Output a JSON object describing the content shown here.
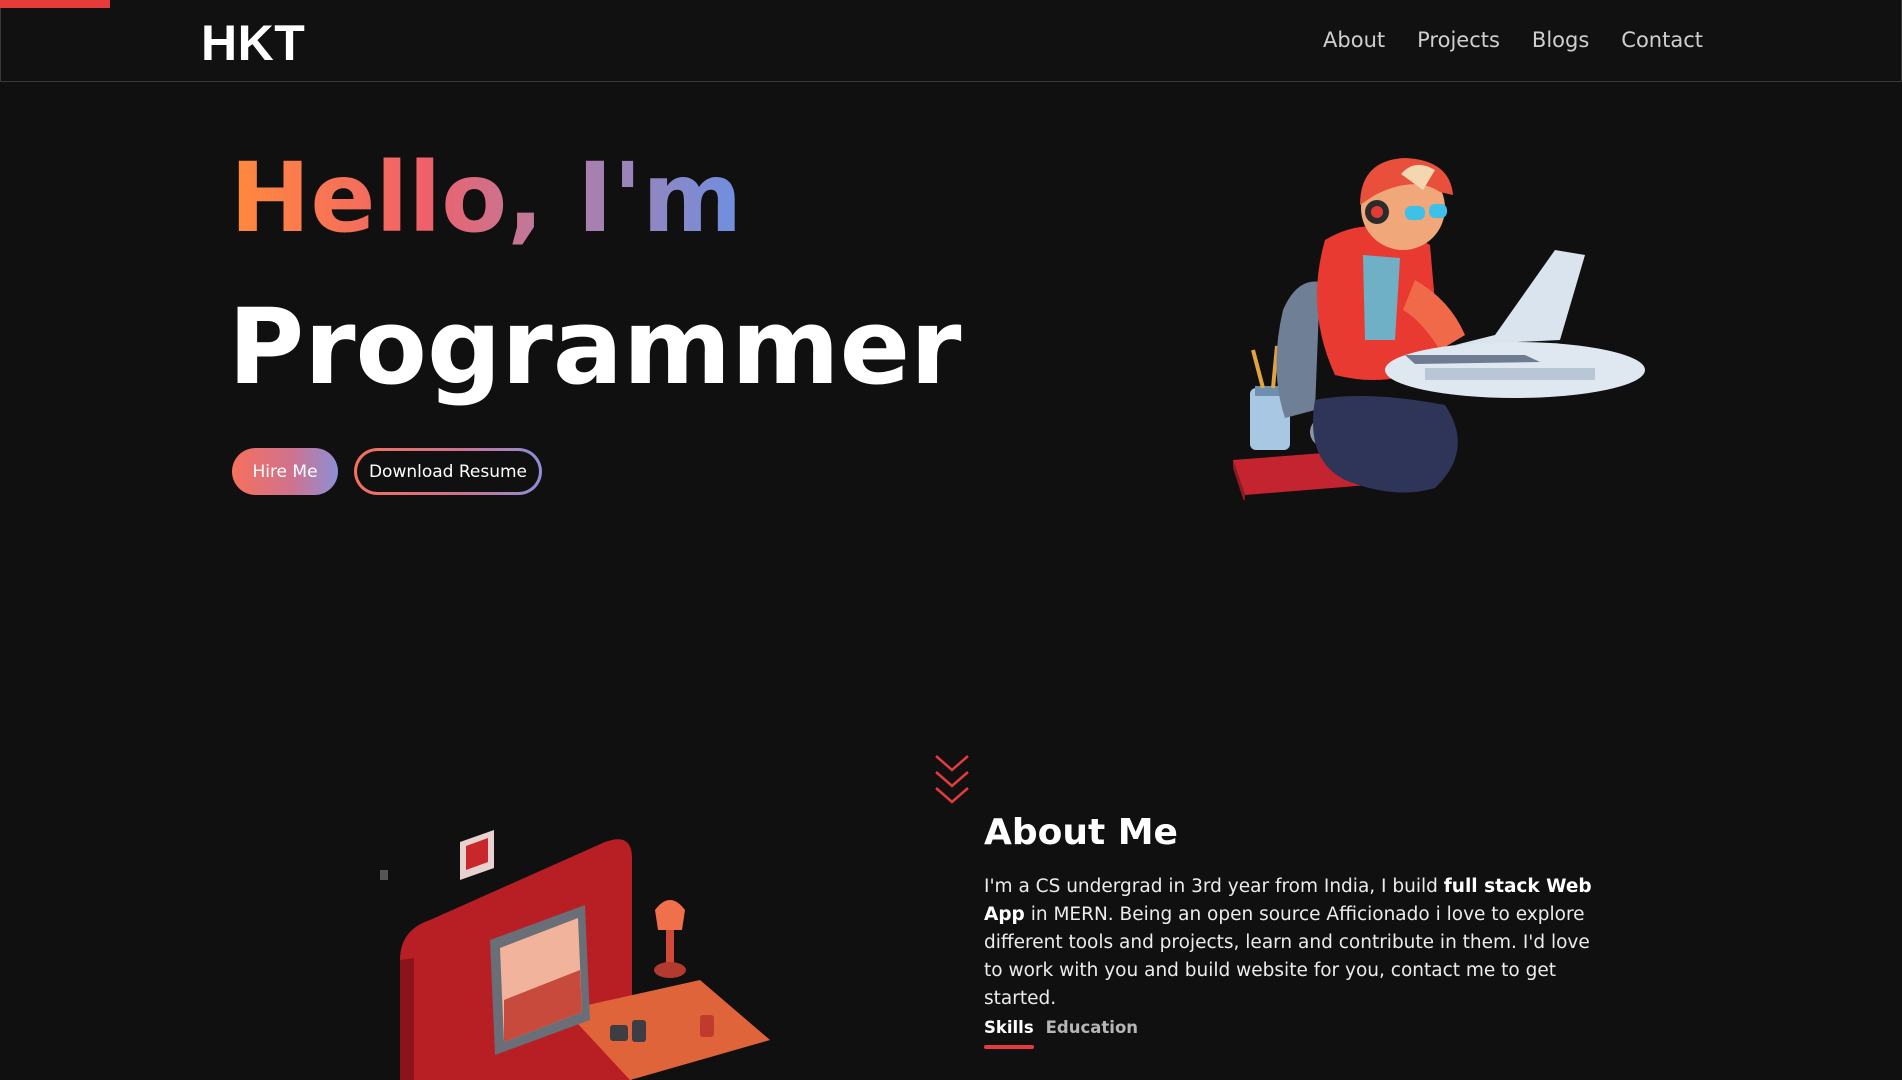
{
  "nav": {
    "brand": "HKT",
    "links": [
      "About",
      "Projects",
      "Blogs",
      "Contact"
    ]
  },
  "hero": {
    "greeting": "Hello, I'm",
    "role": "Programmer",
    "hire_label": "Hire Me",
    "resume_label": "Download Resume"
  },
  "about": {
    "title": "About Me",
    "text_before": "I'm a CS undergrad in 3rd year from India, I build ",
    "text_bold": "full stack Web App",
    "text_after": " in MERN. Being an open source Afficionado i love to explore different tools and projects, learn and contribute in them. I'd love to work with you and build website for you, contact me to get started.",
    "tabs": [
      "Skills",
      "Education"
    ]
  },
  "colors": {
    "accent": "#e63b3b",
    "background": "#111011",
    "gradient_start": "#ff8a3d",
    "gradient_end": "#6e8fe0"
  },
  "icons": {
    "scroll_indicator": "chevron-down-icon"
  }
}
